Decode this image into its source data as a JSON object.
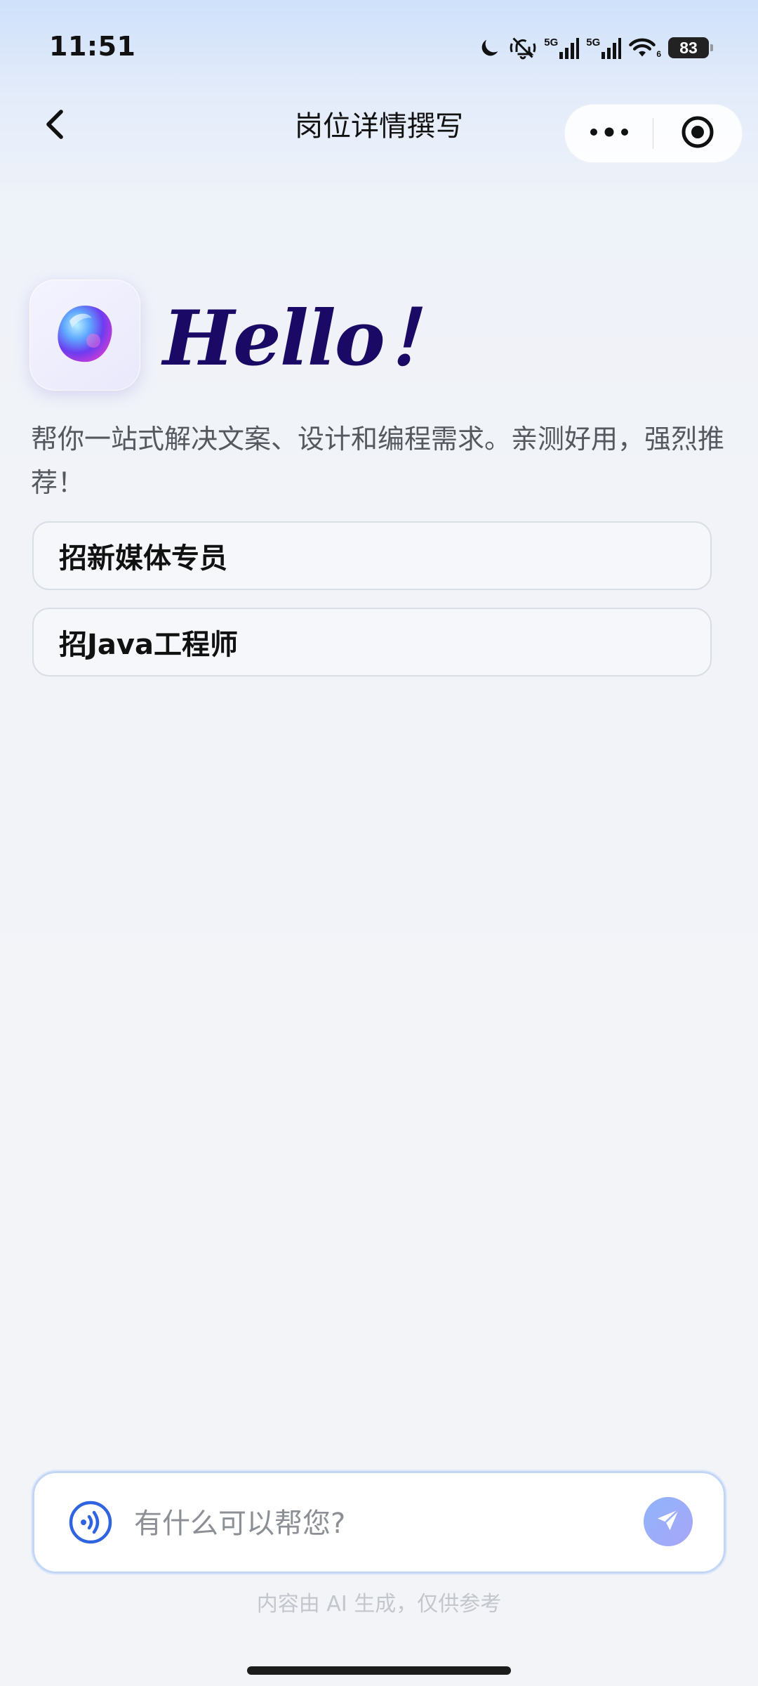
{
  "status_bar": {
    "time": "11:51",
    "network_1": "5G",
    "network_2": "5G",
    "wifi_sub": "6",
    "battery": "83",
    "icons": [
      "moon-icon",
      "mute-bell-icon",
      "signal-icon",
      "signal-icon",
      "wifi-icon",
      "battery-icon"
    ]
  },
  "nav": {
    "title": "岗位详情撰写",
    "icons": [
      "chevron-left-icon",
      "more-dots-icon",
      "record-target-icon"
    ]
  },
  "hero": {
    "greeting": "Hello！",
    "description": "帮你一站式解决文案、设计和编程需求。亲测好用，强烈推荐！",
    "logo_icon": "gradient-orb-icon"
  },
  "suggestions": [
    {
      "label": "招新媒体专员"
    },
    {
      "label": "招Java工程师"
    }
  ],
  "composer": {
    "placeholder": "有什么可以帮您?",
    "value": "",
    "voice_icon": "voice-wave-icon",
    "send_icon": "paper-plane-icon"
  },
  "footer": {
    "disclaimer": "内容由 AI 生成，仅供参考"
  },
  "colors": {
    "accent": "#2f63e0",
    "greeting": "#1a0a66",
    "send_button": "#9db0fa"
  }
}
